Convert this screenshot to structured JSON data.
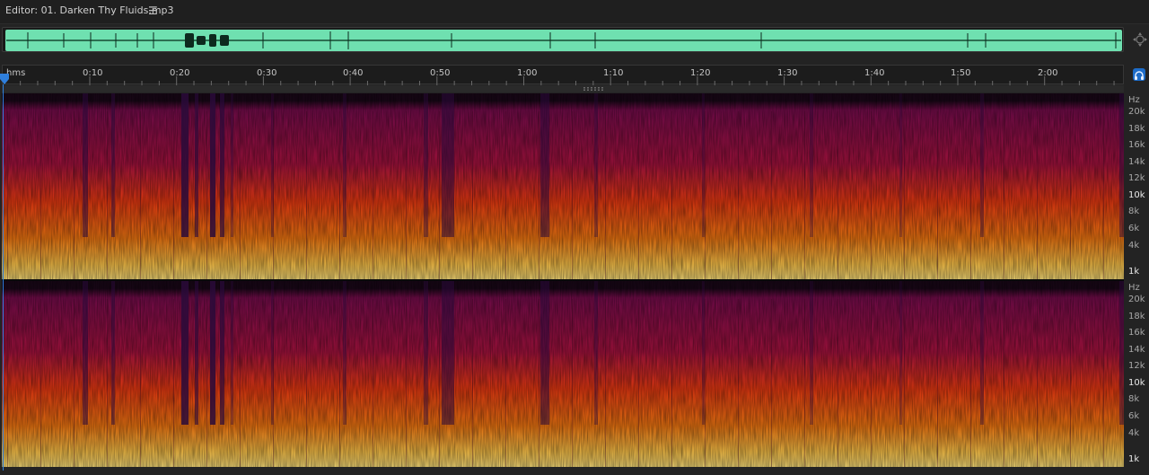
{
  "editor": {
    "title": "Editor: 01. Darken Thy Fluids.mp3"
  },
  "icons": {
    "menu": "hamburger-menu-icon",
    "zoom_navigator": "zoom-navigator-icon",
    "sync": "sync-headphones-icon",
    "playhead": "playhead-marker-icon"
  },
  "ruler": {
    "format_label": "hms",
    "labels": [
      "0:10",
      "0:20",
      "0:30",
      "0:40",
      "0:50",
      "1:00",
      "1:10",
      "1:20",
      "1:30",
      "1:40",
      "1:50",
      "2:00"
    ]
  },
  "spectral": {
    "unit": "Hz",
    "freq_labels": [
      "20k",
      "18k",
      "16k",
      "14k",
      "12k",
      "10k",
      "8k",
      "6k",
      "4k",
      "1k"
    ],
    "highlighted": [
      "10k",
      "1k"
    ]
  },
  "colors": {
    "overview_waveform": "#6fe0b0",
    "spectrum_low": "#ffe27a",
    "spectrum_mid": "#ee3a12",
    "spectrum_high": "#7a0c4e",
    "spectrum_top": "#1a0718",
    "playhead": "#2f7fdc"
  }
}
